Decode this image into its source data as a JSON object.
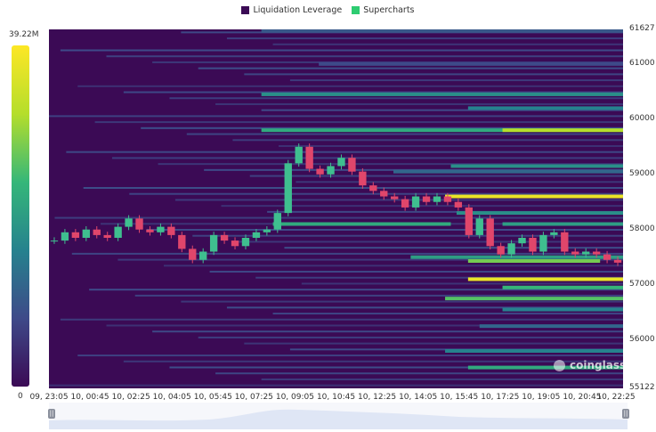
{
  "legend": [
    {
      "label": "Liquidation Leverage",
      "color": "#3b0a55"
    },
    {
      "label": "Supercharts",
      "color": "#2ecc71"
    }
  ],
  "colorbar": {
    "max_label": "39.22M",
    "min_label": "0",
    "colors": [
      "#3b0a55",
      "#3e4a89",
      "#26828e",
      "#35b779",
      "#b5de2b",
      "#fde725"
    ]
  },
  "watermark": "coinglass",
  "chart_data": {
    "type": "heatmap",
    "y_ticks": [
      "61627",
      "61000",
      "60000",
      "59000",
      "58000",
      "57000",
      "56000",
      "55122"
    ],
    "x_ticks": [
      "09, 23:05",
      "10, 00:45",
      "10, 02:25",
      "10, 04:05",
      "10, 05:45",
      "10, 07:25",
      "10, 09:05",
      "10, 10:45",
      "10, 12:25",
      "10, 14:05",
      "10, 15:45",
      "10, 17:25",
      "10, 19:05",
      "10, 20:45",
      "10, 22:25"
    ],
    "ylim": [
      55122,
      61627
    ],
    "price_series": [
      57800,
      57950,
      57850,
      58000,
      57900,
      57850,
      58050,
      58200,
      58000,
      57950,
      58050,
      57900,
      57650,
      57450,
      57600,
      57900,
      57800,
      57700,
      57850,
      57950,
      58000,
      58300,
      59200,
      59500,
      59100,
      59000,
      59150,
      59300,
      59050,
      58800,
      58700,
      58600,
      58550,
      58400,
      58600,
      58500,
      58600,
      58500,
      58400,
      57900,
      58200,
      57700,
      57550,
      57750,
      57850,
      57600,
      57900,
      57950,
      57600,
      57550,
      57600,
      57550,
      57450,
      57400
    ],
    "bands": [
      {
        "price": 61600,
        "x0": 0.37,
        "x1": 1.0,
        "level": 0.25
      },
      {
        "price": 61000,
        "x0": 0.47,
        "x1": 1.0,
        "level": 0.2
      },
      {
        "price": 60450,
        "x0": 0.37,
        "x1": 1.0,
        "level": 0.45
      },
      {
        "price": 60200,
        "x0": 0.73,
        "x1": 1.0,
        "level": 0.4
      },
      {
        "price": 59800,
        "x0": 0.37,
        "x1": 1.0,
        "level": 0.55
      },
      {
        "price": 59800,
        "x0": 0.79,
        "x1": 1.0,
        "level": 0.8
      },
      {
        "price": 59150,
        "x0": 0.7,
        "x1": 1.0,
        "level": 0.45
      },
      {
        "price": 59050,
        "x0": 0.6,
        "x1": 1.0,
        "level": 0.3
      },
      {
        "price": 58600,
        "x0": 0.69,
        "x1": 1.0,
        "level": 0.95
      },
      {
        "price": 58300,
        "x0": 0.71,
        "x1": 1.0,
        "level": 0.45
      },
      {
        "price": 58100,
        "x0": 0.39,
        "x1": 0.7,
        "level": 0.55
      },
      {
        "price": 58100,
        "x0": 0.79,
        "x1": 1.0,
        "level": 0.5
      },
      {
        "price": 57500,
        "x0": 0.63,
        "x1": 1.0,
        "level": 0.5
      },
      {
        "price": 57430,
        "x0": 0.73,
        "x1": 0.96,
        "level": 0.7
      },
      {
        "price": 57100,
        "x0": 0.73,
        "x1": 1.0,
        "level": 0.95
      },
      {
        "price": 56950,
        "x0": 0.79,
        "x1": 1.0,
        "level": 0.6
      },
      {
        "price": 56750,
        "x0": 0.69,
        "x1": 1.0,
        "level": 0.65
      },
      {
        "price": 56550,
        "x0": 0.79,
        "x1": 1.0,
        "level": 0.4
      },
      {
        "price": 56250,
        "x0": 0.75,
        "x1": 1.0,
        "level": 0.3
      },
      {
        "price": 55800,
        "x0": 0.69,
        "x1": 1.0,
        "level": 0.4
      },
      {
        "price": 55500,
        "x0": 0.73,
        "x1": 1.0,
        "level": 0.55
      }
    ]
  }
}
